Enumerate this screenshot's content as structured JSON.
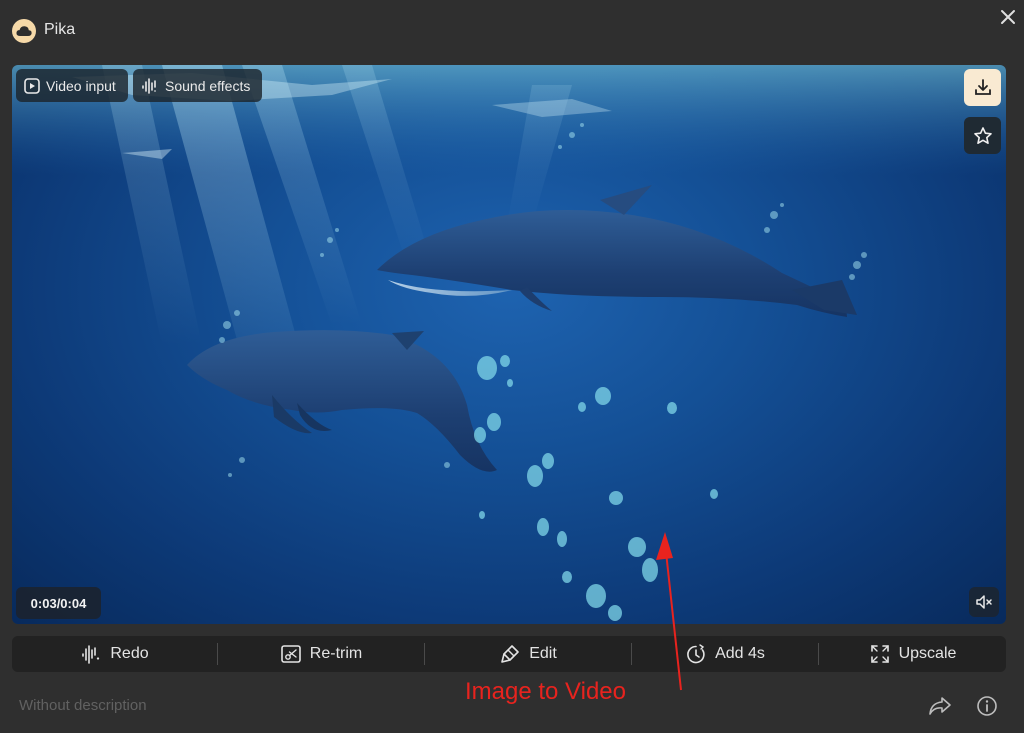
{
  "app": {
    "title": "Pika"
  },
  "video": {
    "chips": {
      "video_input": "Video input",
      "sound_effects": "Sound effects"
    },
    "time": "0:03/0:04"
  },
  "toolbar": {
    "redo": "Redo",
    "retrim": "Re-trim",
    "edit": "Edit",
    "add": "Add 4s",
    "upscale": "Upscale"
  },
  "annotation": {
    "text": "Image to Video",
    "color": "#e8231e"
  },
  "footer": {
    "description": "Without description"
  },
  "icons": [
    "cloud-logo-icon",
    "close-icon",
    "play-icon",
    "waveform-icon",
    "download-icon",
    "star-icon",
    "mute-icon",
    "redo-icon",
    "retrim-icon",
    "brush-icon",
    "timer-icon",
    "expand-icon",
    "share-icon",
    "info-icon"
  ]
}
